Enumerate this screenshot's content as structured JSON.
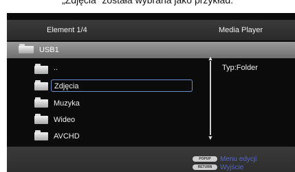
{
  "caption": "„Zdjęcia” została wybrana jako przykład.",
  "header": {
    "counter": "Element  1/4",
    "app_title": "Media Player"
  },
  "path": {
    "icon": "folder-icon",
    "label": "USB1"
  },
  "list": {
    "items": [
      {
        "label": "..",
        "icon": "folder-up-icon"
      },
      {
        "label": "Zdjęcia",
        "icon": "folder-icon",
        "selected": true
      },
      {
        "label": "Muzyka",
        "icon": "folder-icon"
      },
      {
        "label": "Wideo",
        "icon": "folder-icon"
      },
      {
        "label": "AVCHD",
        "icon": "folder-icon"
      }
    ]
  },
  "info": {
    "type_label": "Typ:Folder"
  },
  "footer": {
    "popup_key": "POPUP",
    "popup_label": "Menu edycji",
    "return_key": "RETURN",
    "return_label": "Wyjście"
  },
  "colors": {
    "background": "#0b0b0b",
    "selection_border": "#6a8fc9",
    "hint_text": "#5567c8"
  }
}
